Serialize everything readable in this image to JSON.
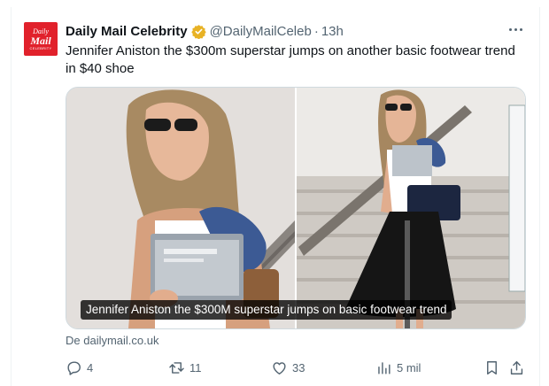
{
  "account": {
    "avatar_line1": "Daily",
    "avatar_line2": "Mail",
    "avatar_line3": "CELEBRITY",
    "name": "Daily Mail Celebrity",
    "handle": "@DailyMailCeleb",
    "separator": "·",
    "time": "13h",
    "verified_color": "#e8b225"
  },
  "tweet": {
    "text": "Jennifer Aniston the $300m superstar jumps on another basic footwear trend in $40 shoe"
  },
  "media": {
    "caption": "Jennifer Aniston the $300M superstar jumps on basic footwear trend"
  },
  "source": {
    "label": "De dailymail.co.uk"
  },
  "actions": {
    "reply_count": "4",
    "retweet_count": "11",
    "like_count": "33",
    "views_count": "5 mil"
  },
  "colors": {
    "brand": "#e1212b",
    "text": "#0f1419",
    "muted": "#536471",
    "border": "#cfd9de"
  },
  "icons": [
    "verified-badge-icon",
    "more-options-icon",
    "reply-icon",
    "retweet-icon",
    "like-icon",
    "views-icon",
    "bookmark-icon",
    "share-icon"
  ]
}
